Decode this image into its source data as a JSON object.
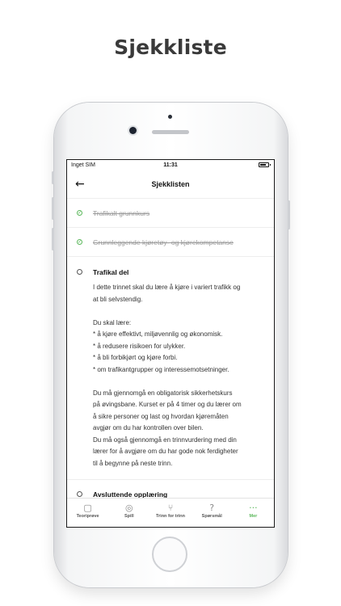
{
  "headline": "Sjekkliste",
  "status_bar": {
    "carrier": "Inget SIM",
    "time": "11:31",
    "battery_level": 0.75
  },
  "nav": {
    "back_icon": "arrow-left-icon",
    "title": "Sjekklisten"
  },
  "items": [
    {
      "label": "Trafikalt grunnkurs",
      "state": "done"
    },
    {
      "label": "Grunnleggende kjøretøy- og kjørekompetanse",
      "state": "done"
    },
    {
      "label": "Trafikal del",
      "state": "todo",
      "expanded": true,
      "lines": [
        "I dette trinnet skal du lære å kjøre i variert trafikk og",
        "at bli selvstendig.",
        "",
        "Du skal lære:",
        "* å kjøre effektivt, miljøvennlig og økonomisk.",
        "* å redusere risikoen for ulykker.",
        "* å bli forbikjørt og kjøre forbi.",
        "* om trafikantgrupper og interessemotsetninger.",
        "",
        "Du må gjennomgå en obligatorisk sikkerhetskurs",
        "på øvingsbane. Kurset er på 4 timer og du lærer om",
        "å sikre personer og last og hvordan kjøremåten",
        "avgjør om du har kontrollen over bilen.",
        "Du må også gjennomgå en trinnvurdering med din",
        "lærer for å avgjøre om du har gode nok ferdigheter",
        "til å begynne på neste trinn."
      ]
    },
    {
      "label": "Avsluttende opplæring",
      "state": "todo"
    }
  ],
  "tabbar": [
    {
      "label": "Teoriprøve",
      "icon": "clipboard-icon",
      "glyph": "▢",
      "active": false
    },
    {
      "label": "Spill",
      "icon": "game-icon",
      "glyph": "◎",
      "active": false
    },
    {
      "label": "Trinn for trinn",
      "icon": "route-icon",
      "glyph": "⑂",
      "active": false
    },
    {
      "label": "Spørsmål",
      "icon": "chat-question-icon",
      "glyph": "?",
      "active": false
    },
    {
      "label": "Mer",
      "icon": "more-dots-icon",
      "glyph": "···",
      "active": true
    }
  ],
  "colors": {
    "accent": "#5cb85c",
    "text": "#111111",
    "muted": "#9a9a9a"
  }
}
